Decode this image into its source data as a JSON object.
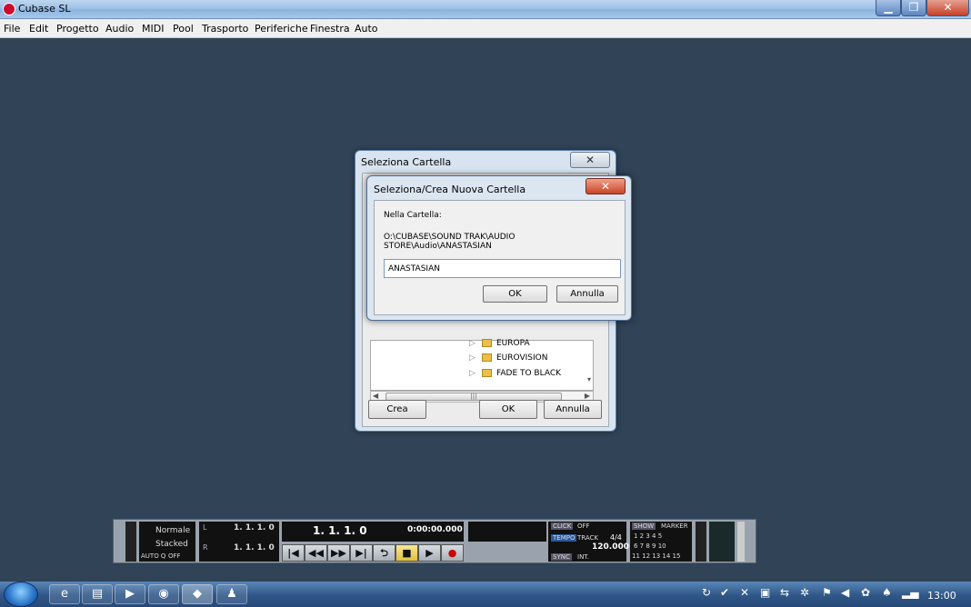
{
  "window": {
    "title": "Cubase SL",
    "minimize": "▁",
    "maximize": "❐",
    "close": "✕"
  },
  "menu": [
    "File",
    "Edit",
    "Progetto",
    "Audio",
    "MIDI",
    "Pool",
    "Trasporto",
    "Periferiche",
    "Finestra",
    "Auto"
  ],
  "outer_dialog": {
    "title": "Seleziona Cartella",
    "close": "✕",
    "folders": [
      "EUROPA",
      "EUROVISION",
      "FADE TO BLACK"
    ],
    "scroll_thumb": "|||",
    "scroll_left": "◀",
    "scroll_right": "▶",
    "scroll_down": "▾",
    "create_label": "Crea",
    "ok_label": "OK",
    "cancel_label": "Annulla"
  },
  "inner_dialog": {
    "title": "Seleziona/Crea Nuova Cartella",
    "close": "✕",
    "folder_label": "Nella Cartella:",
    "path": "O:\\CUBASE\\SOUND TRAK\\AUDIO STORE\\Audio\\ANASTASIAN",
    "new_name_value": "ANASTASIAN",
    "ok_label": "OK",
    "cancel_label": "Annulla"
  },
  "transport": {
    "mode1": "Normale",
    "mode2": "Stacked",
    "auto_q": "AUTO Q",
    "auto_q_val": "OFF",
    "left_label": "L",
    "right_label": "R",
    "left_pos": "1. 1. 1. 0",
    "right_pos": "1. 1. 1. 0",
    "main_pos": "1. 1. 1. 0",
    "time": "0:00:00.000",
    "click": "CLICK",
    "click_val": "OFF",
    "tempo": "TEMPO",
    "tempo_val": "TRACK",
    "signature": "4/4",
    "bpm": "120.000",
    "sync": "SYNC",
    "sync_val": "INT.",
    "show": "SHOW",
    "marker": "MARKER",
    "marker_row1": "1  2  3  4  5",
    "marker_row2": "6  7  8  9  10",
    "marker_row3": "11 12 13 14 15",
    "btn_start": "|◀",
    "btn_rew": "◀◀",
    "btn_ff": "▶▶",
    "btn_end": "▶|",
    "btn_cycle": "⮌",
    "btn_stop": "■",
    "btn_play": "▶",
    "btn_rec": "●"
  },
  "taskbar": {
    "ie": "e",
    "explorer": "▤",
    "media": "▶",
    "firefox": "◉",
    "cubase": "◆",
    "other": "♟",
    "clock": "13:00"
  },
  "colors": {
    "workspace": "#304357",
    "accent_blue": "#5a86b8",
    "close_red": "#c8452a"
  }
}
